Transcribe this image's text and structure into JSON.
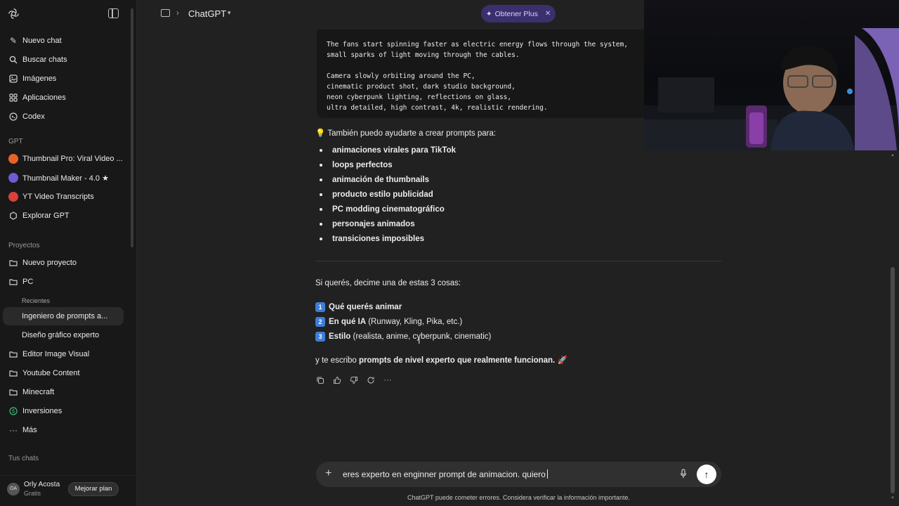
{
  "sidebar": {
    "nav": [
      {
        "label": "Nuevo chat",
        "icon": "edit-icon"
      },
      {
        "label": "Buscar chats",
        "icon": "search-icon"
      },
      {
        "label": "Imágenes",
        "icon": "image-icon"
      },
      {
        "label": "Aplicaciones",
        "icon": "apps-icon"
      },
      {
        "label": "Codex",
        "icon": "codex-icon"
      }
    ],
    "gpt_section": "GPT",
    "gpts": [
      {
        "label": "Thumbnail Pro: Viral Video ...",
        "color": "#e8632b"
      },
      {
        "label": "Thumbnail Maker - 4.0 ★",
        "color": "#6f5bd3"
      },
      {
        "label": "YT Video Transcripts",
        "color": "#d9413a"
      },
      {
        "label": "Explorar GPT",
        "icon": "explore-icon"
      }
    ],
    "projects_section": "Proyectos",
    "projects": {
      "new_project": "Nuevo proyecto",
      "pc": "PC",
      "recents_label": "Recientes",
      "pc_chats": [
        "Ingeniero de prompts a...",
        "Diseño gráfico experto"
      ],
      "others": [
        "Editor Image Visual",
        "Youtube Content",
        "Minecraft",
        "Inversiones"
      ],
      "more": "Más"
    },
    "your_chats": "Tus chats",
    "user": {
      "initials": "OA",
      "name": "Orly Acosta",
      "plan": "Gratis",
      "upgrade": "Mejorar plan"
    }
  },
  "header": {
    "title": "ChatGPT",
    "plus_label": "Obtener Plus"
  },
  "code_lines": [
    "The fans start spinning faster as electric energy flows through the system,",
    "small sparks of light moving through the cables.",
    "",
    "Camera slowly orbiting around the PC,",
    "cinematic product shot, dark studio background,",
    "neon cyberpunk lighting, reflections on glass,",
    "ultra detailed, high contrast, 4k, realistic rendering."
  ],
  "message": {
    "intro_emoji": "💡",
    "intro": "También puedo ayudarte a crear prompts para:",
    "bullets": [
      "animaciones virales para TikTok",
      "loops perfectos",
      "animación de thumbnails",
      "producto estilo publicidad",
      "PC modding cinematográfico",
      "personajes animados",
      "transiciones imposibles"
    ],
    "ask": "Si querés, decime una de estas 3 cosas:",
    "options": [
      {
        "num": "1",
        "bold": "Qué querés animar",
        "rest": ""
      },
      {
        "num": "2",
        "bold": "En qué IA",
        "rest": " (Runway, Kling, Pika, etc.)"
      },
      {
        "num": "3",
        "bold": "Estilo",
        "rest": " (realista, anime, cyberpunk, cinematic)"
      }
    ],
    "closing_pre": "y te escribo ",
    "closing_bold": "prompts de nivel experto que realmente funcionan.",
    "closing_emoji": "🚀"
  },
  "composer": {
    "text": "eres experto en enginner prompt de animacion. quiero",
    "disclaimer": "ChatGPT puede cometer errores. Considera verificar la información importante."
  },
  "colors": {
    "accent_pill": "#3b2f6e",
    "number_badge": "#3c7dd9"
  }
}
